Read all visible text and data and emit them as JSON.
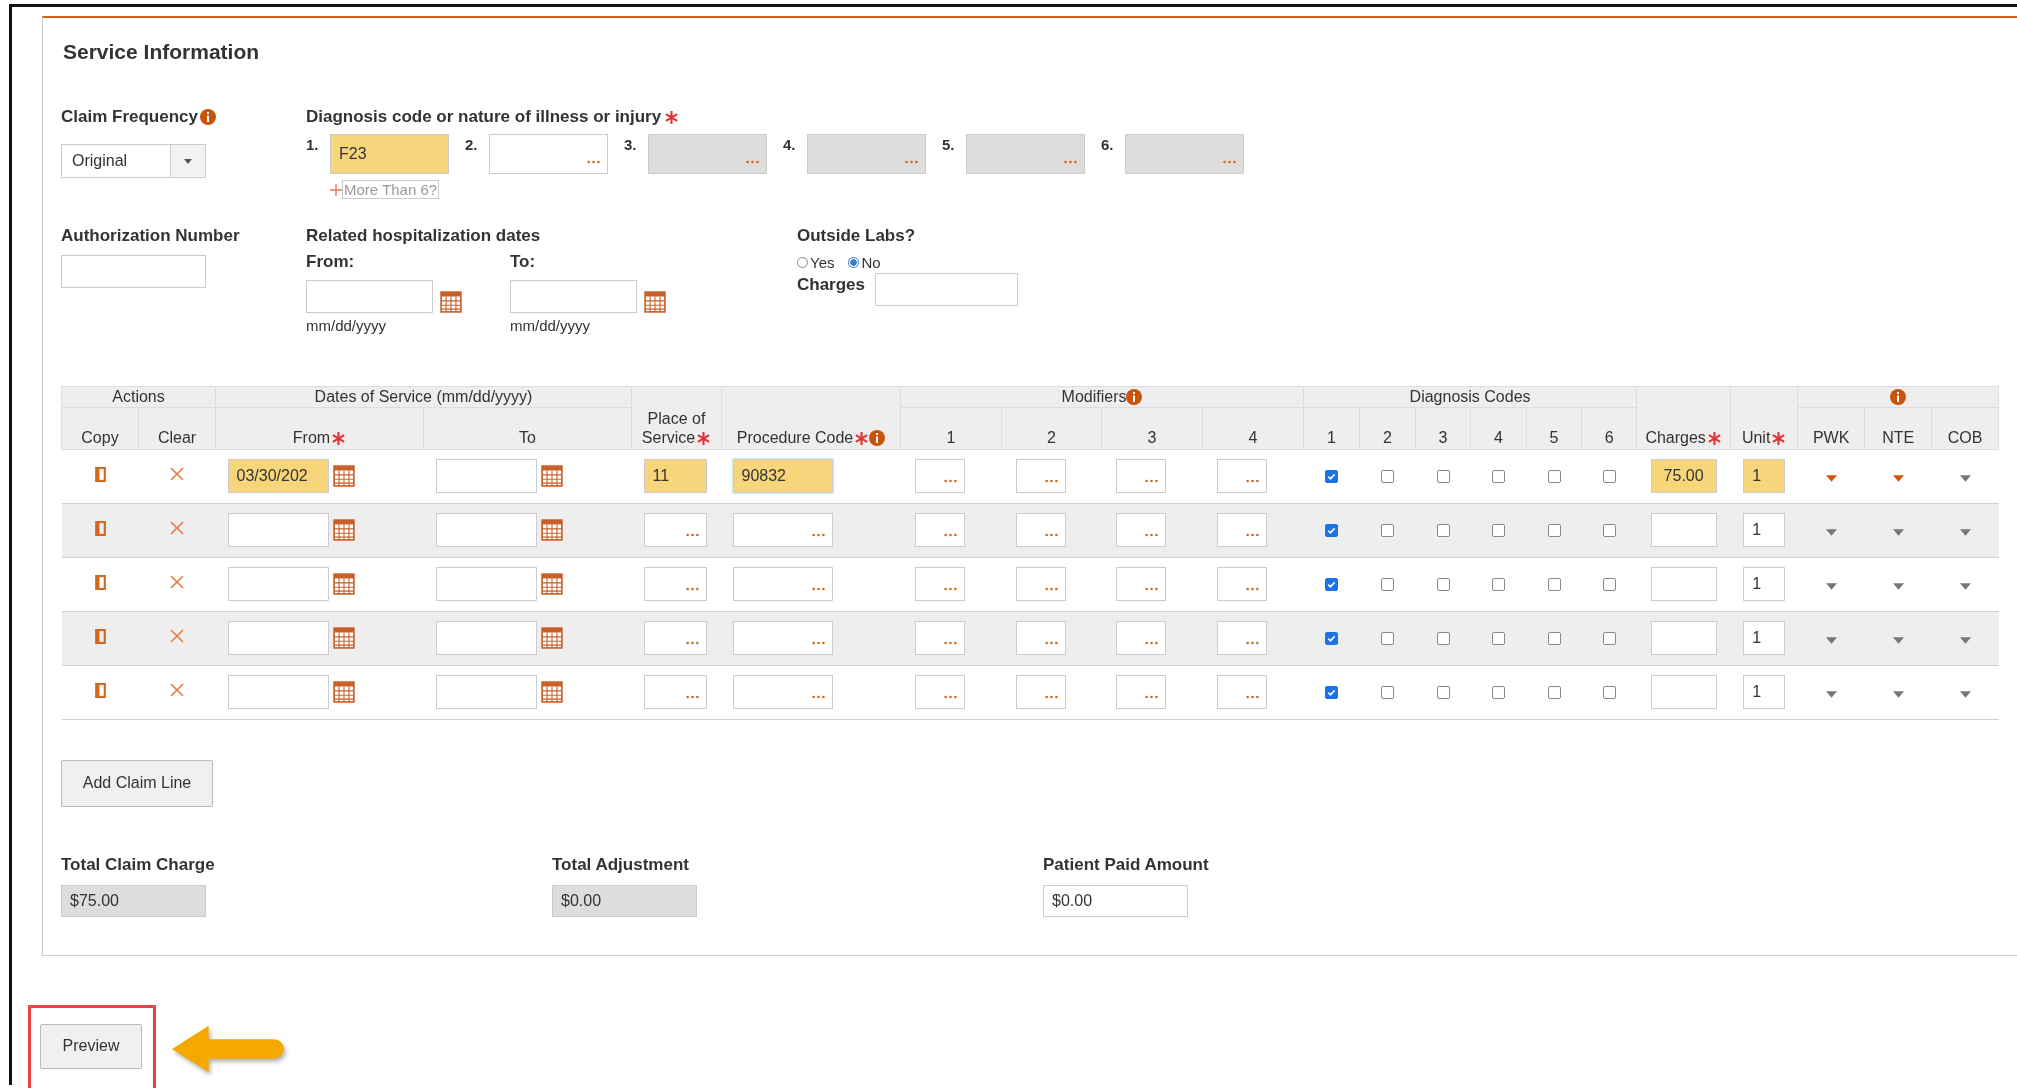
{
  "section_title": "Service Information",
  "claim_frequency": {
    "label": "Claim Frequency",
    "value": "Original"
  },
  "diagnosis": {
    "label": "Diagnosis code or nature of illness or injury",
    "codes": [
      {
        "number": "1.",
        "value": "F23",
        "highlighted": true,
        "disabled": false
      },
      {
        "number": "2.",
        "highlighted": false,
        "disabled": false
      },
      {
        "number": "3.",
        "highlighted": false,
        "disabled": true
      },
      {
        "number": "4.",
        "highlighted": false,
        "disabled": true
      },
      {
        "number": "5.",
        "highlighted": false,
        "disabled": true
      },
      {
        "number": "6.",
        "highlighted": false,
        "disabled": true
      }
    ],
    "more_link": "More Than 6?"
  },
  "authorization": {
    "label": "Authorization Number"
  },
  "hospitalization": {
    "label": "Related hospitalization dates",
    "from_label": "From:",
    "to_label": "To:",
    "from_hint": "mm/dd/yyyy",
    "to_hint": "mm/dd/yyyy"
  },
  "outside_labs": {
    "label": "Outside Labs?",
    "options": [
      {
        "label": "Yes",
        "selected": false
      },
      {
        "label": "No",
        "selected": true
      }
    ],
    "charges_label": "Charges"
  },
  "table": {
    "header": {
      "actions": "Actions",
      "copy": "Copy",
      "clear": "Clear",
      "dates": "Dates of Service (mm/dd/yyyy)",
      "from": "From",
      "to": "To",
      "place": "Place of Service",
      "procedure": "Procedure Code",
      "modifiers": "Modifiers",
      "modifier_columns": [
        "1",
        "2",
        "3",
        "4"
      ],
      "diagnosis": "Diagnosis Codes",
      "diagnosis_columns": [
        "1",
        "2",
        "3",
        "4",
        "5",
        "6"
      ],
      "charges": "Charges",
      "unit": "Unit",
      "pwk": "PWK",
      "nte": "NTE",
      "cob": "COB"
    },
    "rows": [
      {
        "from": "03/30/202",
        "place": "11",
        "procedure": "90832",
        "charges": "75.00",
        "unit": "1",
        "highlighted": true,
        "diagnosis_pointers": [
          true,
          false,
          false,
          false,
          false,
          false
        ],
        "dropdown_alerts": [
          true,
          true,
          false
        ]
      },
      {
        "unit": "1",
        "highlighted": false,
        "diagnosis_pointers": [
          true,
          false,
          false,
          false,
          false,
          false
        ],
        "dropdown_alerts": [
          false,
          false,
          false
        ]
      },
      {
        "unit": "1",
        "highlighted": false,
        "diagnosis_pointers": [
          true,
          false,
          false,
          false,
          false,
          false
        ],
        "dropdown_alerts": [
          false,
          false,
          false
        ]
      },
      {
        "unit": "1",
        "highlighted": false,
        "diagnosis_pointers": [
          true,
          false,
          false,
          false,
          false,
          false
        ],
        "dropdown_alerts": [
          false,
          false,
          false
        ]
      },
      {
        "unit": "1",
        "highlighted": false,
        "diagnosis_pointers": [
          true,
          false,
          false,
          false,
          false,
          false
        ],
        "dropdown_alerts": [
          false,
          false,
          false
        ]
      }
    ]
  },
  "add_line_button": "Add Claim Line",
  "totals": [
    {
      "label": "Total Claim Charge",
      "value": "$75.00",
      "readonly": true
    },
    {
      "label": "Total Adjustment",
      "value": "$0.00",
      "readonly": true
    },
    {
      "label": "Patient Paid Amount",
      "value": "$0.00",
      "readonly": false
    }
  ],
  "preview_button": "Preview"
}
